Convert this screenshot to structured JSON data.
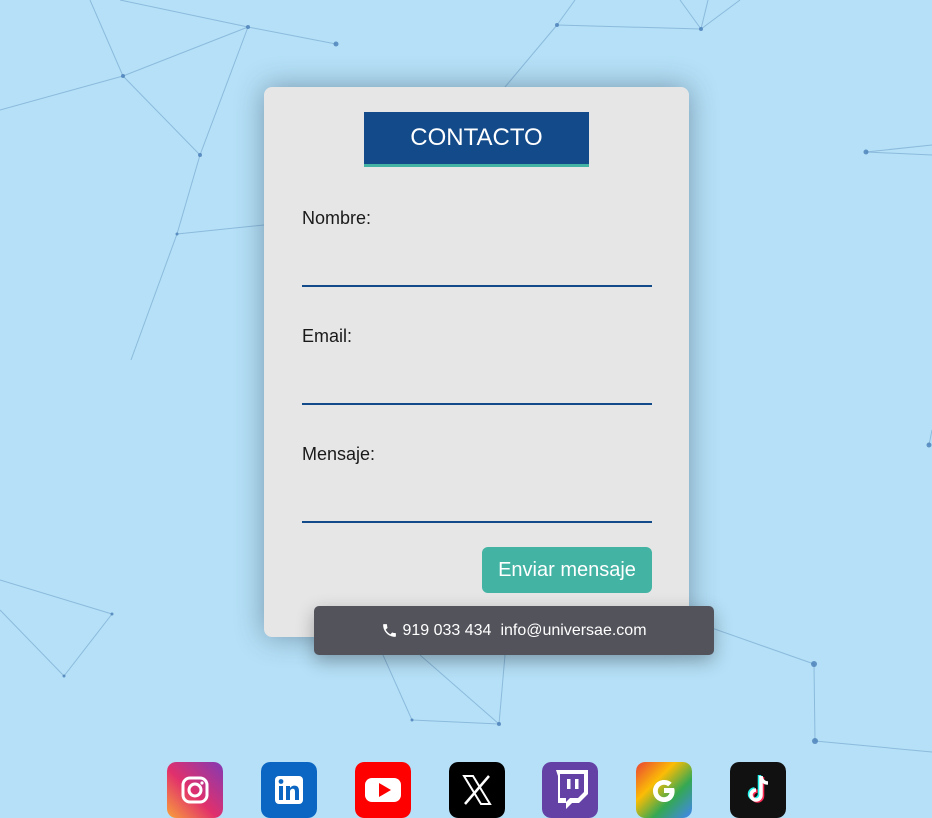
{
  "form": {
    "title": "CONTACTO",
    "fields": [
      {
        "label": "Nombre:",
        "value": ""
      },
      {
        "label": "Email:",
        "value": ""
      },
      {
        "label": "Mensaje:",
        "value": ""
      }
    ],
    "submit_label": "Enviar mensaje"
  },
  "contact": {
    "phone": "919 033 434",
    "email": "info@universae.com"
  },
  "social": [
    {
      "name": "instagram-icon",
      "color": "#d62976"
    },
    {
      "name": "linkedin-icon",
      "color": "#0a66c2"
    },
    {
      "name": "youtube-icon",
      "color": "#ff0000"
    },
    {
      "name": "x-icon",
      "color": "#000000"
    },
    {
      "name": "twitch-icon",
      "color": "#6441a5"
    },
    {
      "name": "google-icon",
      "color": "#4285f4"
    },
    {
      "name": "tiktok-icon",
      "color": "#111111"
    }
  ],
  "colors": {
    "background": "#b5e0f7",
    "primary": "#124a8a",
    "accent": "#43b3a4",
    "card": "#e6e6e6",
    "contact_bar": "#53535c"
  }
}
